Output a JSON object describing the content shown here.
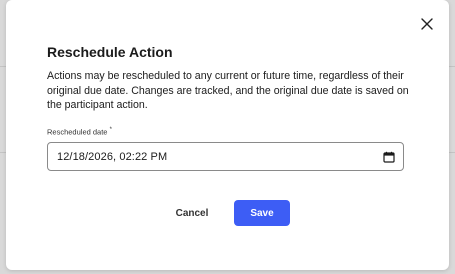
{
  "dialog": {
    "title": "Reschedule Action",
    "description": "Actions may be rescheduled to any current or future time, regardless of their original due date. Changes are tracked, and the original due date is saved on the participant action.",
    "close_icon": "close-icon"
  },
  "form": {
    "rescheduled_date": {
      "label": "Rescheduled date",
      "required_marker": "*",
      "value": "12/18/2026, 02:22 PM",
      "icon": "calendar-icon"
    }
  },
  "actions": {
    "cancel_label": "Cancel",
    "save_label": "Save"
  },
  "colors": {
    "primary": "#3d5df5",
    "text": "#1b1b1b",
    "backdrop": "#d9d9d9"
  }
}
